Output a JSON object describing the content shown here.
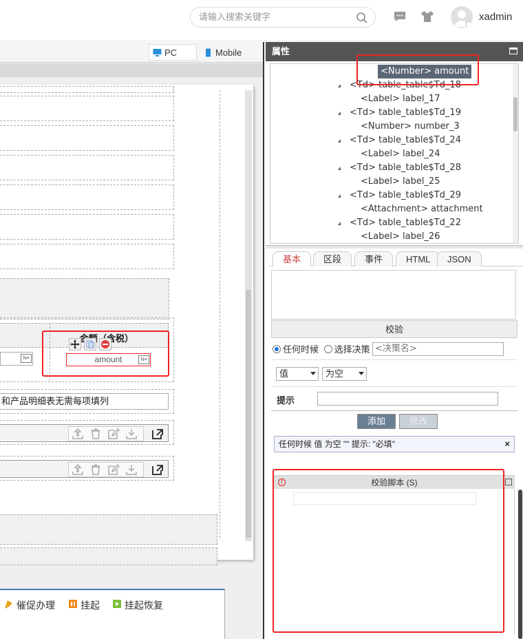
{
  "header": {
    "search_placeholder": "请输入搜索关键字",
    "username": "xadmin"
  },
  "designer": {
    "modes": [
      "PC",
      "Mobile"
    ],
    "table_column_title": "金额（含税）",
    "amount_field": "amount",
    "note_text": "和产品明细表无需每项填列",
    "actions": [
      "催促办理",
      "挂起",
      "挂起恢复"
    ]
  },
  "properties": {
    "title": "属性",
    "tree": [
      {
        "text": "<Number> amount",
        "indent": 2,
        "arrow": false,
        "selected": true
      },
      {
        "text": "<Td> table_table$Td_18",
        "indent": 1,
        "arrow": true
      },
      {
        "text": "<Label> label_17",
        "indent": 2,
        "arrow": false
      },
      {
        "text": "<Td> table_table$Td_19",
        "indent": 1,
        "arrow": true
      },
      {
        "text": "<Number> number_3",
        "indent": 2,
        "arrow": false
      },
      {
        "text": "<Td> table_table$Td_24",
        "indent": 1,
        "arrow": true
      },
      {
        "text": "<Label> label_24",
        "indent": 2,
        "arrow": false
      },
      {
        "text": "<Td> table_table$Td_28",
        "indent": 1,
        "arrow": true
      },
      {
        "text": "<Label> label_25",
        "indent": 2,
        "arrow": false
      },
      {
        "text": "<Td> table_table$Td_29",
        "indent": 1,
        "arrow": true
      },
      {
        "text": "<Attachment> attachment",
        "indent": 2,
        "arrow": false
      },
      {
        "text": "<Td> table_table$Td_22",
        "indent": 1,
        "arrow": true
      },
      {
        "text": "<Label> label_26",
        "indent": 2,
        "arrow": false
      }
    ],
    "tabs": [
      "基本",
      "区段",
      "事件",
      "HTML",
      "JSON"
    ],
    "active_tab": 0,
    "validation": {
      "title": "校验",
      "radio_anytime": "任何时候",
      "radio_choose": "选择决策",
      "decision_placeholder": "<决策名>",
      "select_value": "值",
      "select_condition": "为空",
      "hint_label": "提示",
      "add_button": "添加",
      "modify_button": "修改",
      "rule_text": "任何时候 值 为空 \"\" 提示: \"必填\"",
      "rule_close": "×",
      "script_title": "校验脚本 (S)"
    }
  }
}
